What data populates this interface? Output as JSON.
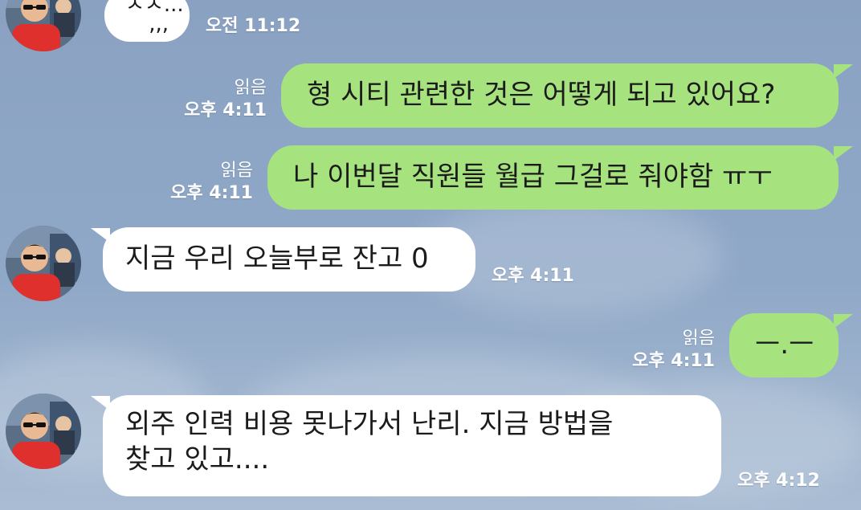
{
  "colors": {
    "incoming_bubble": "#ffffff",
    "outgoing_bubble": "#a6e37f",
    "background": "#8ea6c6",
    "meta_text": "#ffffff"
  },
  "avatar_icon": "profile-photo",
  "messages": [
    {
      "direction": "in",
      "lines": [
        "ㅅㅅ...",
        ",,,"
      ],
      "time": "오전 11:12"
    },
    {
      "direction": "out",
      "read": "읽음",
      "text": "형 시티 관련한 것은 어떻게 되고 있어요?",
      "time": "오후 4:11"
    },
    {
      "direction": "out",
      "read": "읽음",
      "text": "나 이번달 직원들 월급 그걸로 줘야함 ㅠㅜ",
      "time": "오후 4:11"
    },
    {
      "direction": "in",
      "text": "지금 우리 오늘부로 잔고 0",
      "time": "오후 4:11"
    },
    {
      "direction": "out",
      "read": "읽음",
      "text": "ㅡ.ㅡ",
      "time": "오후 4:11"
    },
    {
      "direction": "in",
      "lines": [
        "외주 인력 비용 못나가서 난리. 지금 방법을",
        "찾고 있고...."
      ],
      "time": "오후 4:12"
    }
  ]
}
